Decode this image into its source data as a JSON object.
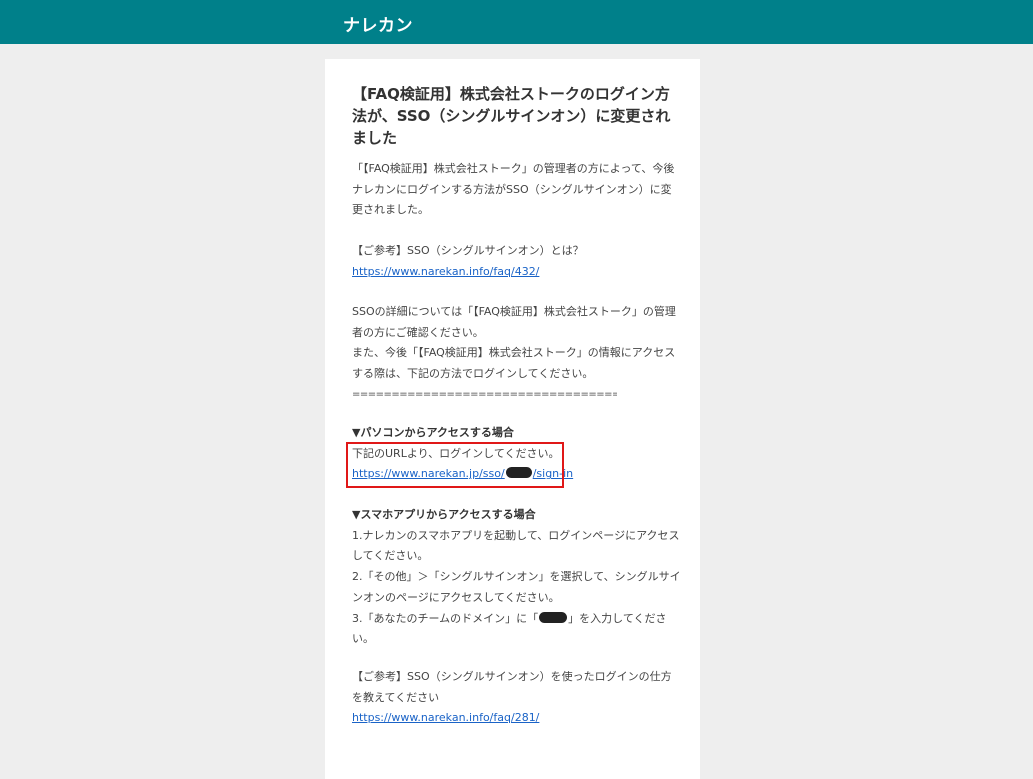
{
  "header": {
    "brand": "ナレカン"
  },
  "email": {
    "title": "【FAQ検証用】株式会社ストークのログイン方法が、SSO（シングルサインオン）に変更されました",
    "intro": "「【FAQ検証用】株式会社ストーク」の管理者の方によって、今後ナレカンにログインする方法がSSO（シングルサインオン）に変更されました。",
    "ref1_label": "【ご参考】SSO（シングルサインオン）とは？",
    "ref1_url": "https://www.narekan.info/faq/432/",
    "details_line1": "SSOの詳細については「【FAQ検証用】株式会社ストーク」の管理者の方にご確認ください。",
    "details_line2": "また、今後「【FAQ検証用】株式会社ストーク」の情報にアクセスする際は、下記の方法でログインしてください。",
    "separator": "========================================",
    "pc_heading": "▼パソコンからアクセスする場合",
    "pc_text": "下記のURLより、ログインしてください。",
    "pc_url_prefix": "https://www.narekan.jp/sso/",
    "pc_url_suffix": "/sign-in",
    "app_heading": "▼スマホアプリからアクセスする場合",
    "app_step1": "1.ナレカンのスマホアプリを起動して、ログインページにアクセスしてください。",
    "app_step2": "2.「その他」＞「シングルサインオン」を選択して、シングルサインオンのページにアクセスしてください。",
    "app_step3_prefix": "3.「あなたのチームのドメイン」に「",
    "app_step3_suffix": "」を入力してください。",
    "ref2_label": "【ご参考】SSO（シングルサインオン）を使ったログインの仕方を教えてください",
    "ref2_url": "https://www.narekan.info/faq/281/"
  },
  "colors": {
    "header_bg": "#00808a",
    "link": "#1a63c7",
    "highlight": "#e01818"
  }
}
